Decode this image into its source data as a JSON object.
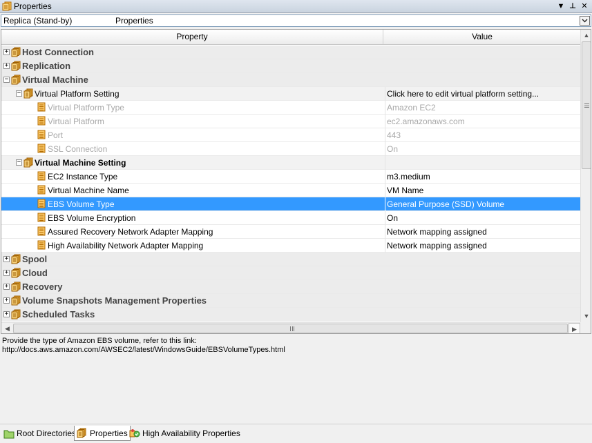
{
  "window": {
    "title": "Properties"
  },
  "title_buttons": {
    "dropdown": "▼",
    "pin": "⊥",
    "close": "✕"
  },
  "combo": {
    "left_text": "Replica (Stand-by)",
    "right_text": "Properties",
    "arrow": "⌄"
  },
  "grid": {
    "headers": {
      "property": "Property",
      "value": "Value"
    },
    "rows": [
      {
        "type": "cat",
        "level": 0,
        "expander": "+",
        "name": "Host Connection",
        "value": ""
      },
      {
        "type": "cat",
        "level": 0,
        "expander": "+",
        "name": "Replication",
        "value": ""
      },
      {
        "type": "cat",
        "level": 0,
        "expander": "−",
        "name": "Virtual Machine",
        "value": ""
      },
      {
        "type": "sub",
        "level": 1,
        "expander": "−",
        "name": "Virtual Platform Setting",
        "value": "Click here to edit virtual platform setting..."
      },
      {
        "type": "leaf",
        "level": 2,
        "disabled": true,
        "name": "Virtual Platform Type",
        "value": "Amazon EC2"
      },
      {
        "type": "leaf",
        "level": 2,
        "disabled": true,
        "name": "Virtual Platform",
        "value": "ec2.amazonaws.com"
      },
      {
        "type": "leaf",
        "level": 2,
        "disabled": true,
        "name": "Port",
        "value": "443"
      },
      {
        "type": "leaf",
        "level": 2,
        "disabled": true,
        "name": "SSL Connection",
        "value": "On"
      },
      {
        "type": "sub",
        "level": 1,
        "expander": "−",
        "bold": true,
        "name": "Virtual Machine Setting",
        "value": ""
      },
      {
        "type": "leaf",
        "level": 2,
        "name": "EC2 Instance Type",
        "value": "m3.medium"
      },
      {
        "type": "leaf",
        "level": 2,
        "name": "Virtual Machine Name",
        "value": "VM Name"
      },
      {
        "type": "leaf",
        "level": 2,
        "selected": true,
        "name": "EBS Volume Type",
        "value": "General Purpose (SSD) Volume"
      },
      {
        "type": "leaf",
        "level": 2,
        "name": "EBS Volume Encryption",
        "value": "On"
      },
      {
        "type": "leaf",
        "level": 2,
        "name": "Assured Recovery Network Adapter Mapping",
        "value": "Network mapping assigned"
      },
      {
        "type": "leaf",
        "level": 2,
        "name": "High Availability Network Adapter Mapping",
        "value": "Network mapping assigned"
      },
      {
        "type": "cat",
        "level": 0,
        "expander": "+",
        "name": "Spool",
        "value": ""
      },
      {
        "type": "cat",
        "level": 0,
        "expander": "+",
        "name": "Cloud",
        "value": ""
      },
      {
        "type": "cat",
        "level": 0,
        "expander": "+",
        "name": "Recovery",
        "value": ""
      },
      {
        "type": "cat",
        "level": 0,
        "expander": "+",
        "name": "Volume Snapshots Management Properties",
        "value": ""
      },
      {
        "type": "cat",
        "level": 0,
        "expander": "+",
        "name": "Scheduled Tasks",
        "value": ""
      }
    ]
  },
  "description": {
    "line1": "Provide the type of Amazon EBS volume, refer to this link:",
    "line2": "http://docs.aws.amazon.com/AWSEC2/latest/WindowsGuide/EBSVolumeTypes.html"
  },
  "tabs": [
    {
      "label": "Root Directories",
      "icon": "folder-icon",
      "active": false
    },
    {
      "label": "Properties",
      "icon": "properties-icon",
      "active": true
    },
    {
      "label": "High Availability Properties",
      "icon": "high-availability-icon",
      "active": false
    }
  ],
  "colors": {
    "selection": "#3399ff",
    "category_bg": "#ececec",
    "icon_orange": "#e89a1c"
  }
}
